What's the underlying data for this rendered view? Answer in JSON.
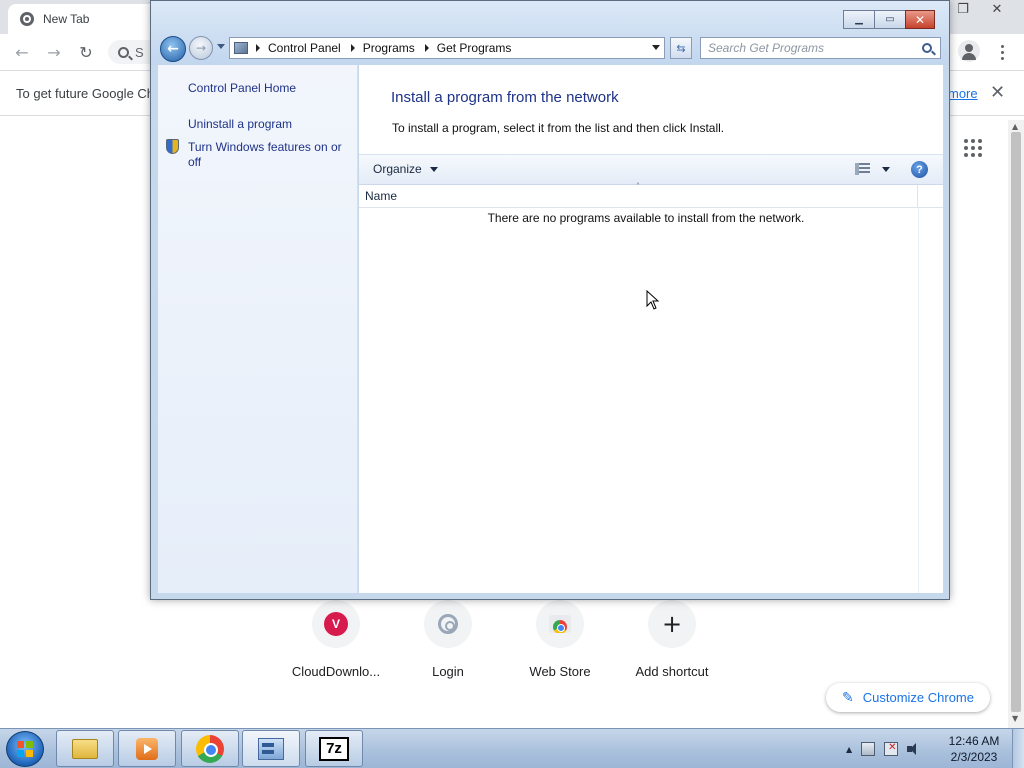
{
  "chrome": {
    "tab_title": "New Tab",
    "omnibox_text": "S",
    "infobar_text": "To get future Google Ch",
    "infobar_link": "more",
    "shortcuts": [
      {
        "label": "CloudDownlo...",
        "letter": "V"
      },
      {
        "label": "Login"
      },
      {
        "label": "Web Store"
      },
      {
        "label": "Add shortcut",
        "symbol": "+"
      }
    ],
    "customize_label": "Customize Chrome",
    "accent_color": "#1a73e8"
  },
  "control_panel": {
    "breadcrumbs": [
      "Control Panel",
      "Programs",
      "Get Programs"
    ],
    "search_placeholder": "Search Get Programs",
    "nav": {
      "home": "Control Panel Home",
      "uninstall": "Uninstall a program",
      "features": "Turn Windows features on or off"
    },
    "heading": "Install a program from the network",
    "description": "To install a program, select it from the list and then click Install.",
    "toolbar": {
      "organize_label": "Organize",
      "help_symbol": "?"
    },
    "list": {
      "columns": [
        "Name"
      ],
      "empty_message": "There are no programs available to install from the network."
    },
    "heading_color": "#1e3287"
  },
  "taskbar": {
    "items": [
      "windows-explorer",
      "media-player",
      "google-chrome",
      "control-panel",
      "7-zip"
    ],
    "seven_zip_label": "7z",
    "time": "12:46 AM",
    "date": "2/3/2023"
  }
}
